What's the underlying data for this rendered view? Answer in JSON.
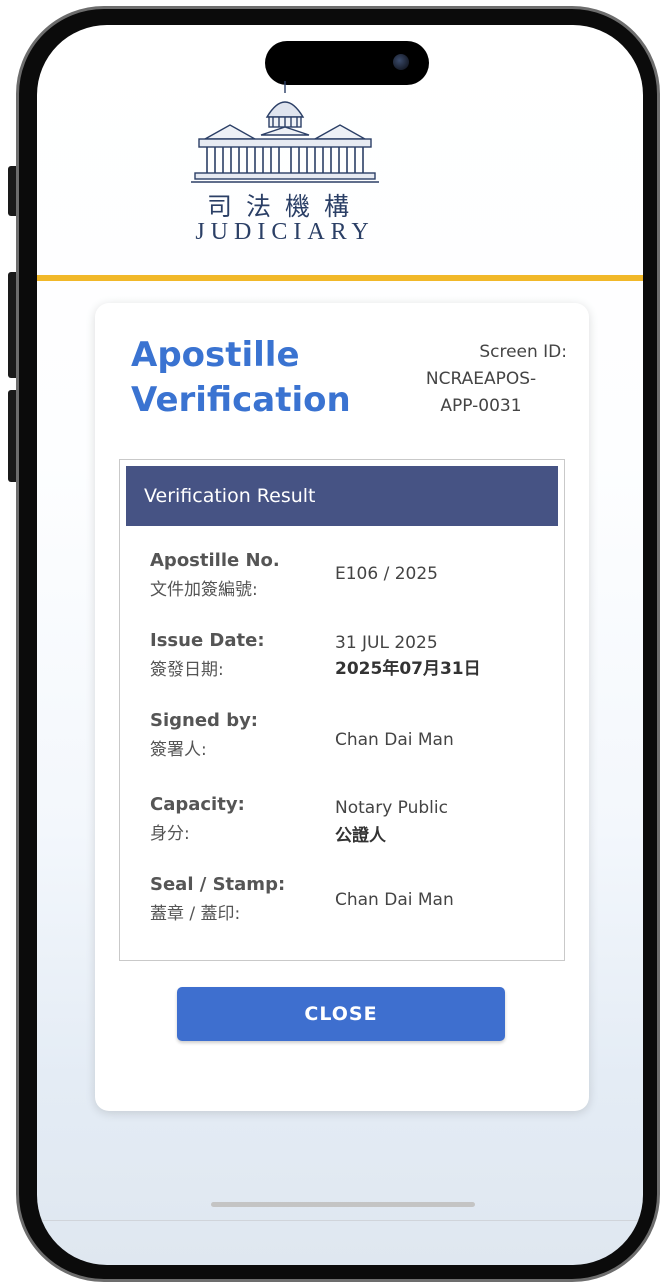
{
  "logo": {
    "chinese": "司法機構",
    "english": "JUDICIARY"
  },
  "page": {
    "title_line1": "Apostille",
    "title_line2": "Verification",
    "screen_id_label": "Screen ID:",
    "screen_id_line1": "NCRAEAPOS-",
    "screen_id_line2": "APP-0031"
  },
  "result": {
    "header": "Verification Result",
    "rows": [
      {
        "label_en": "Apostille No.",
        "label_zh": "文件加簽編號:",
        "value": "E106 / 2025",
        "value_zh": ""
      },
      {
        "label_en": "Issue Date:",
        "label_zh": "簽發日期:",
        "value": "31 JUL 2025",
        "value_zh": "2025年07月31日"
      },
      {
        "label_en": "Signed by:",
        "label_zh": "簽署人:",
        "value": "Chan Dai Man",
        "value_zh": ""
      },
      {
        "label_en": "Capacity:",
        "label_zh": "身分:",
        "value": "Notary Public",
        "value_zh": "公證人"
      },
      {
        "label_en": "Seal / Stamp:",
        "label_zh": "蓋章 / 蓋印:",
        "value": "Chan Dai Man",
        "value_zh": ""
      }
    ]
  },
  "actions": {
    "close_label": "CLOSE"
  },
  "colors": {
    "title": "#3a73d1",
    "header_bg": "#465384",
    "button_bg": "#3e6fcf",
    "accent_bar": "#f1b829"
  }
}
